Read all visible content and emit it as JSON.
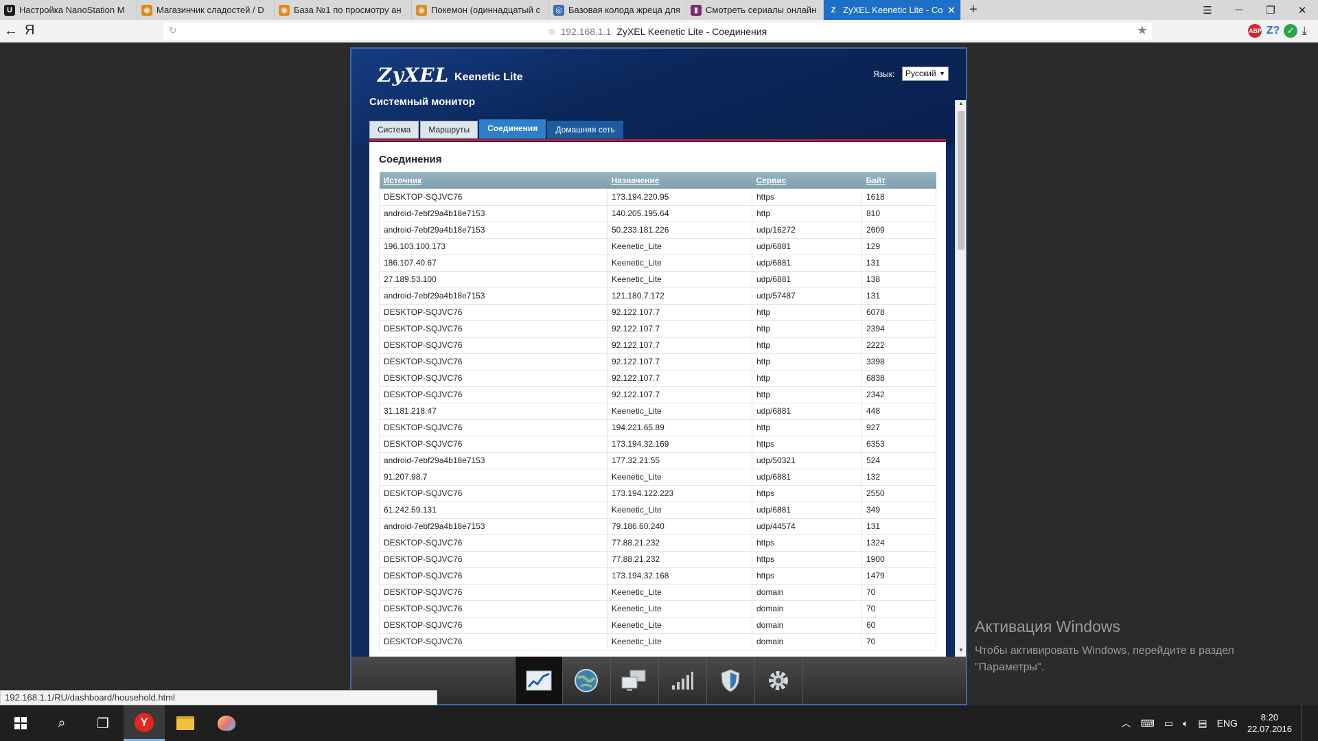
{
  "browser": {
    "tabs": [
      {
        "title": "Настройка NanoStation M",
        "favicon": "ubiquiti-icon",
        "color": "#1a1a1a",
        "glyph": "U"
      },
      {
        "title": "Магазинчик сладостей / D",
        "favicon": "tiger-icon",
        "color": "#e08a1e",
        "glyph": "◉"
      },
      {
        "title": "База №1 по просмотру ан",
        "favicon": "tiger-icon",
        "color": "#e08a1e",
        "glyph": "◉"
      },
      {
        "title": "Покемон (одиннадцатый с",
        "favicon": "tiger-icon",
        "color": "#e08a1e",
        "glyph": "◉"
      },
      {
        "title": "Базовая колода жреца для",
        "favicon": "swirl-icon",
        "color": "#3a6fb0",
        "glyph": "◎"
      },
      {
        "title": "Смотреть сериалы онлайн",
        "favicon": "film-icon",
        "color": "#7b2a6e",
        "glyph": "▮"
      },
      {
        "title": "ZyXEL Keenetic Lite - Coe",
        "favicon": "zyxel-icon",
        "color": "#1d6fc7",
        "glyph": "Z",
        "active": true
      }
    ],
    "url_host": "192.168.1.1",
    "url_title": "ZyXEL Keenetic Lite - Соединения",
    "status_url": "192.168.1.1/RU/dashboard/household.html"
  },
  "router": {
    "brand": "ZyXEL",
    "model": "Keenetic Lite",
    "language_label": "Язык:",
    "language_value": "Русский",
    "page_title": "Системный монитор",
    "tabs": [
      {
        "label": "Система"
      },
      {
        "label": "Маршруты"
      },
      {
        "label": "Соединения",
        "active": true
      },
      {
        "label": "Домашняя сеть",
        "hover": true
      }
    ],
    "section_title": "Соединения",
    "table": {
      "headers": [
        "Источник",
        "Назначение",
        "Сервис",
        "Байт"
      ],
      "rows": [
        [
          "DESKTOP-SQJVC76",
          "173.194.220.95",
          "https",
          "1618"
        ],
        [
          "android-7ebf29a4b18e7153",
          "140.205.195.64",
          "http",
          "810"
        ],
        [
          "android-7ebf29a4b18e7153",
          "50.233.181.226",
          "udp/16272",
          "2609"
        ],
        [
          "196.103.100.173",
          "Keenetic_Lite",
          "udp/6881",
          "129"
        ],
        [
          "186.107.40.67",
          "Keenetic_Lite",
          "udp/6881",
          "131"
        ],
        [
          "27.189.53.100",
          "Keenetic_Lite",
          "udp/6881",
          "138"
        ],
        [
          "android-7ebf29a4b18e7153",
          "121.180.7.172",
          "udp/57487",
          "131"
        ],
        [
          "DESKTOP-SQJVC76",
          "92.122.107.7",
          "http",
          "6078"
        ],
        [
          "DESKTOP-SQJVC76",
          "92.122.107.7",
          "http",
          "2394"
        ],
        [
          "DESKTOP-SQJVC76",
          "92.122.107.7",
          "http",
          "2222"
        ],
        [
          "DESKTOP-SQJVC76",
          "92.122.107.7",
          "http",
          "3398"
        ],
        [
          "DESKTOP-SQJVC76",
          "92.122.107.7",
          "http",
          "6838"
        ],
        [
          "DESKTOP-SQJVC76",
          "92.122.107.7",
          "http",
          "2342"
        ],
        [
          "31.181.218.47",
          "Keenetic_Lite",
          "udp/6881",
          "448"
        ],
        [
          "DESKTOP-SQJVC76",
          "194.221.65.89",
          "http",
          "927"
        ],
        [
          "DESKTOP-SQJVC76",
          "173.194.32.169",
          "https",
          "6353"
        ],
        [
          "android-7ebf29a4b18e7153",
          "177.32.21.55",
          "udp/50321",
          "524"
        ],
        [
          "91.207.98.7",
          "Keenetic_Lite",
          "udp/6881",
          "132"
        ],
        [
          "DESKTOP-SQJVC76",
          "173.194.122.223",
          "https",
          "2550"
        ],
        [
          "61.242.59.131",
          "Keenetic_Lite",
          "udp/6881",
          "349"
        ],
        [
          "android-7ebf29a4b18e7153",
          "79.186.60.240",
          "udp/44574",
          "131"
        ],
        [
          "DESKTOP-SQJVC76",
          "77.88.21.232",
          "https",
          "1324"
        ],
        [
          "DESKTOP-SQJVC76",
          "77.88.21.232",
          "https",
          "1900"
        ],
        [
          "DESKTOP-SQJVC76",
          "173.194.32.168",
          "https",
          "1479"
        ],
        [
          "DESKTOP-SQJVC76",
          "Keenetic_Lite",
          "domain",
          "70"
        ],
        [
          "DESKTOP-SQJVC76",
          "Keenetic_Lite",
          "domain",
          "70"
        ],
        [
          "DESKTOP-SQJVC76",
          "Keenetic_Lite",
          "domain",
          "60"
        ],
        [
          "DESKTOP-SQJVC76",
          "Keenetic_Lite",
          "domain",
          "70"
        ]
      ]
    },
    "nav_icons": [
      {
        "name": "monitor-chart-icon",
        "active": true
      },
      {
        "name": "globe-icon"
      },
      {
        "name": "network-computers-icon"
      },
      {
        "name": "wifi-signal-bars-icon"
      },
      {
        "name": "security-shield-icon"
      },
      {
        "name": "settings-gear-icon"
      }
    ]
  },
  "windows": {
    "activation_title": "Активация Windows",
    "activation_text": "Чтобы активировать Windows, перейдите в раздел \"Параметры\".",
    "language": "ENG",
    "time": "8:20",
    "date": "22.07.2016"
  },
  "colors": {
    "accent": "#1d6fc7",
    "router_bg": "#0e2a5e",
    "red_line": "#c8202b"
  }
}
